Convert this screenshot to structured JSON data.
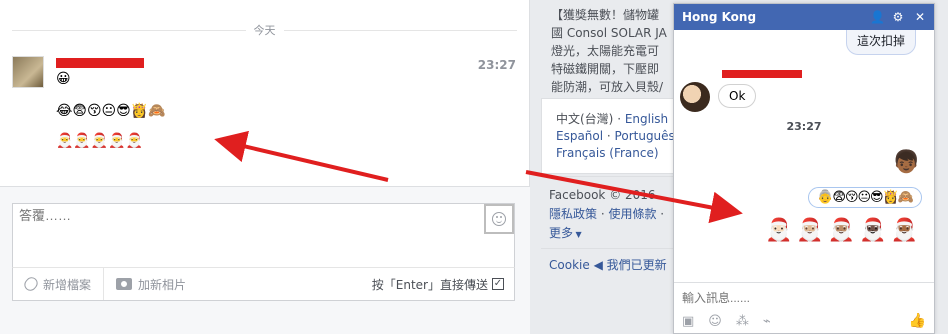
{
  "thread": {
    "day_label": "今天",
    "time": "23:27",
    "emoji_line_1": "😀",
    "emoji_line_2": "😂😨😚😐😎👸🙈",
    "emoji_line_3": "🎅🎅🎅🎅🎅"
  },
  "composer": {
    "placeholder": "答覆……",
    "attach_label": "新增檔案",
    "photo_label": "加新相片",
    "enter_send_label": "按「Enter」直接傳送",
    "enter_send_checked": "✓"
  },
  "sidebar": {
    "promo_lines": [
      "【獲獎無數！儲物罐",
      "國 Consol SOLAR JA",
      "燈光，太陽能充電可",
      "特磁鐵開關，下壓即",
      "能防潮，可放入貝殼/"
    ],
    "languages": {
      "current": "中文(台灣)",
      "sep": " · ",
      "items": [
        "English",
        "Español",
        "Português",
        "Français (France)"
      ]
    },
    "copyright": "Facebook © 2016",
    "privacy": "隱私政策",
    "terms": "使用條款",
    "more": "更多",
    "cookie_label": "Cookie",
    "cookie_update": "◀ 我們已更新"
  },
  "chat": {
    "title": "Hong Kong",
    "top_bubble": "這次扣掉",
    "ok_text": "Ok",
    "time": "23:27",
    "self_avatar": "👦🏾",
    "emoji_bubble": "👵😨😚😐😎👸🙈",
    "santa_row": "🎅🏻🎅🏼🎅🏽🎅🏿🎅🏾",
    "input_placeholder": "輸入訊息......",
    "like_icon": "👍"
  },
  "colors": {
    "brand_blue": "#4267b2",
    "link_blue": "#365899",
    "annotation_red": "#e01f1f"
  }
}
